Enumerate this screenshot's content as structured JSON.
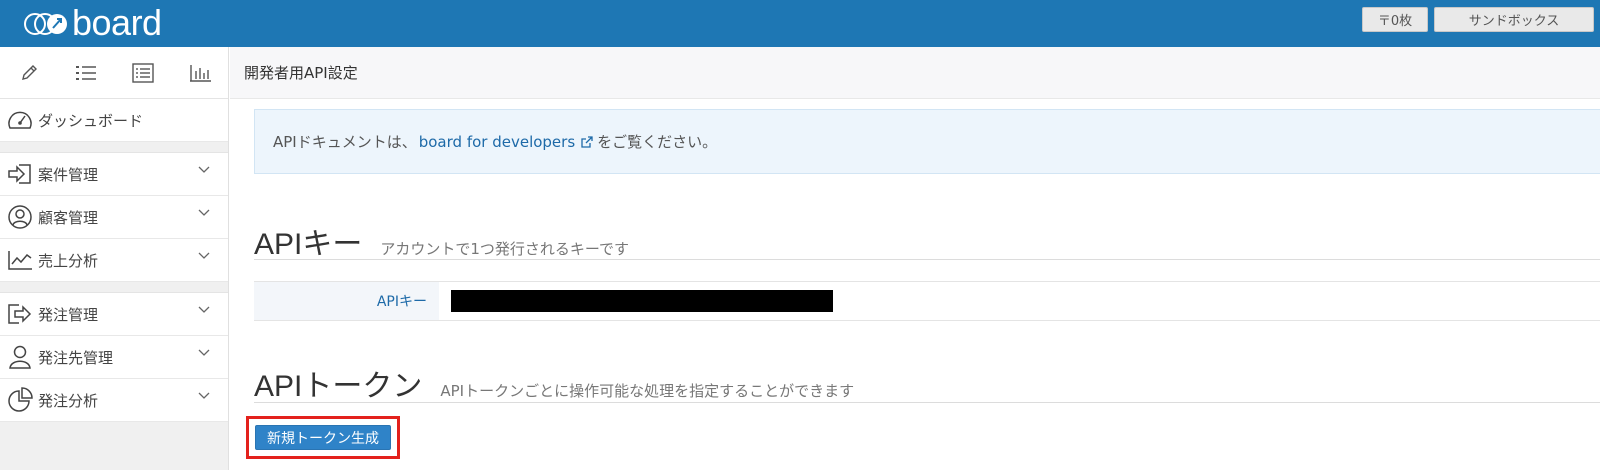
{
  "header": {
    "logo_text": "board",
    "stamp_button": "〒0枚",
    "sandbox_button": "サンドボックス",
    "colors": {
      "bar": "#1e77b4"
    }
  },
  "sidebar": {
    "tools": [
      {
        "icon": "pencil-icon"
      },
      {
        "icon": "list-icon"
      },
      {
        "icon": "detail-list-icon"
      },
      {
        "icon": "bar-chart-icon"
      }
    ],
    "dashboard": {
      "label": "ダッシュボード",
      "icon": "speedometer-icon"
    },
    "group1": [
      {
        "label": "案件管理",
        "icon": "sign-in-icon"
      },
      {
        "label": "顧客管理",
        "icon": "user-circle-icon"
      },
      {
        "label": "売上分析",
        "icon": "line-chart-icon"
      }
    ],
    "group2": [
      {
        "label": "発注管理",
        "icon": "share-icon"
      },
      {
        "label": "発注先管理",
        "icon": "user-icon"
      },
      {
        "label": "発注分析",
        "icon": "pie-chart-icon"
      }
    ]
  },
  "page": {
    "title": "開発者用API設定",
    "notice": {
      "prefix": "APIドキュメントは、",
      "link": "board for developers",
      "suffix": "をご覧ください。"
    },
    "api_key_section": {
      "title": "APIキー",
      "subtitle": "アカウントで1つ発行されるキーです",
      "key_label": "APIキー"
    },
    "api_token_section": {
      "title": "APIトークン",
      "subtitle": "APIトークンごとに操作可能な処理を指定することができます",
      "create_button": "新規トークン生成"
    }
  }
}
